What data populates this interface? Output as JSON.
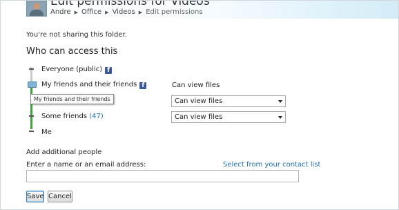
{
  "header": {
    "title": "Edit permissions for Videos",
    "breadcrumb": [
      "Andre",
      "Office",
      "Videos",
      "Edit permissions"
    ]
  },
  "notice": "You're not sharing this folder.",
  "access": {
    "title": "Who can access this",
    "levels": [
      {
        "label": "Everyone (public)",
        "facebook_icon": "f"
      },
      {
        "label": "My friends and their friends",
        "facebook_icon": "f"
      },
      {
        "label": "Some friends",
        "count": "(47)"
      },
      {
        "label": "Me"
      }
    ],
    "selected_level_tooltip": "My friends and their friends",
    "permission_label": "Can view files",
    "dropdowns": [
      {
        "selected": "Can view files"
      },
      {
        "selected": "Can view files"
      }
    ],
    "colors": {
      "rail_active": "#3aa63a",
      "rail_inactive": "#c9c9c9",
      "link": "#1d6fb8",
      "facebook": "#3b5998"
    }
  },
  "add_people": {
    "title": "Add additional people",
    "input_label": "Enter a name or an email address:",
    "input_value": "",
    "contact_link": "Select from your contact list"
  },
  "buttons": {
    "save": "Save",
    "cancel": "Cancel"
  }
}
